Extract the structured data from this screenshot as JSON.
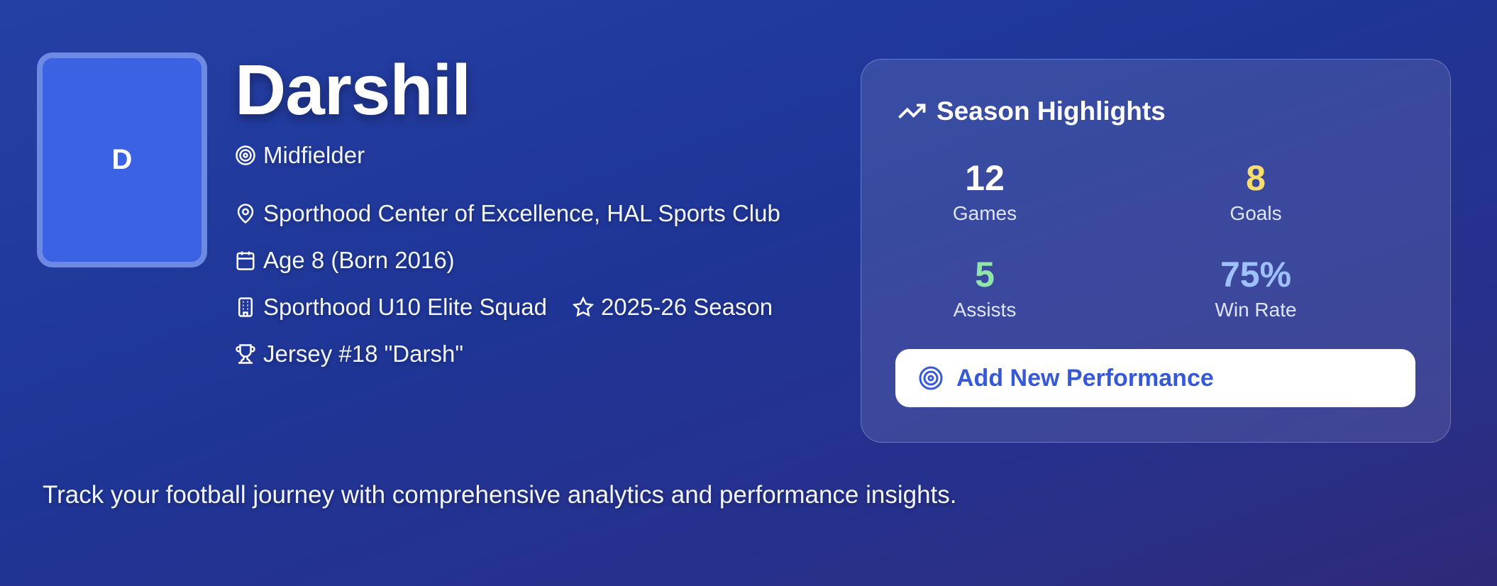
{
  "profile": {
    "initial": "D",
    "name": "Darshil",
    "position": "Midfielder",
    "club": "Sporthood Center of Excellence, HAL Sports Club",
    "age": "Age 8 (Born 2016)",
    "squad": "Sporthood U10 Elite Squad",
    "season": "2025-26 Season",
    "jersey": "Jersey #18 \"Darsh\""
  },
  "highlights": {
    "title": "Season Highlights",
    "stats": [
      {
        "value": "12",
        "label": "Games",
        "color": "#ffffff"
      },
      {
        "value": "8",
        "label": "Goals",
        "color": "#f8de6a"
      },
      {
        "value": "5",
        "label": "Assists",
        "color": "#8fe6a8"
      },
      {
        "value": "75%",
        "label": "Win Rate",
        "color": "#9fc0ff"
      }
    ],
    "button_label": "Add New Performance"
  },
  "tagline": "Track your football journey with comprehensive analytics and performance insights.",
  "icons": [
    "target-icon",
    "map-pin-icon",
    "calendar-icon",
    "building-icon",
    "star-icon",
    "trophy-icon",
    "trending-up-icon"
  ]
}
